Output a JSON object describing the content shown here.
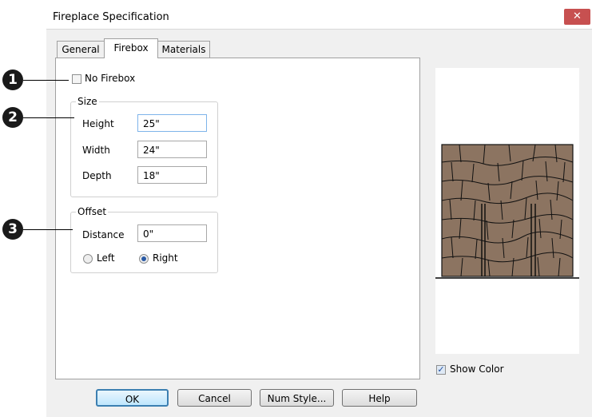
{
  "window": {
    "title": "Fireplace Specification",
    "close_glyph": "✕"
  },
  "tabs": [
    {
      "label": "General",
      "active": false
    },
    {
      "label": "Firebox",
      "active": true
    },
    {
      "label": "Materials",
      "active": false
    }
  ],
  "no_firebox": {
    "label": "No Firebox",
    "checked": false
  },
  "size": {
    "label": "Size",
    "height": {
      "label": "Height",
      "value": "25\""
    },
    "width": {
      "label": "Width",
      "value": "24\""
    },
    "depth": {
      "label": "Depth",
      "value": "18\""
    }
  },
  "offset": {
    "label": "Offset",
    "distance": {
      "label": "Distance",
      "value": "0\""
    },
    "left": {
      "label": "Left",
      "selected": false
    },
    "right": {
      "label": "Right",
      "selected": true
    }
  },
  "preview": {
    "show_color": {
      "label": "Show Color",
      "checked": true
    }
  },
  "buttons": {
    "ok": "OK",
    "cancel": "Cancel",
    "num_style": "Num Style...",
    "help": "Help"
  },
  "callouts": [
    "1",
    "2",
    "3"
  ],
  "colors": {
    "stone": "#8c7461",
    "titlebar_close": "#c75050",
    "accent": "#3c7fb1"
  }
}
